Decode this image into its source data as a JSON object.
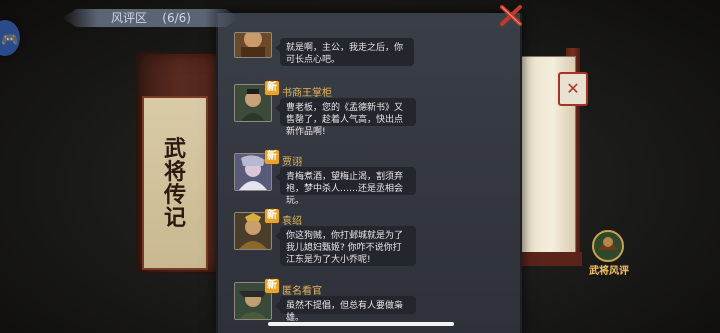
{
  "book": {
    "title_chars": [
      "武",
      "将",
      "传",
      "记"
    ],
    "seal_char": "✕"
  },
  "logo": {
    "text": "武将风评"
  },
  "panel": {
    "title": "风评区",
    "page": "(6/6)",
    "new_tag": "新"
  },
  "comments": [
    {
      "name": "",
      "new": false,
      "text": "就是啊，主公，我走之后，你可长点心吧。"
    },
    {
      "name": "书商王掌柜",
      "new": true,
      "text": "曹老板，您的《孟德新书》又售罄了，趁着人气高，快出点新作品啊!"
    },
    {
      "name": "贾诩",
      "new": true,
      "text": "青梅煮酒，望梅止渴，割须弃袍，梦中杀人……还是丞相会玩。"
    },
    {
      "name": "袁绍",
      "new": true,
      "text": "你这狗贼，你打邺城就是为了我儿媳妇甄姬? 你咋不说你打江东是为了大小乔呢!"
    },
    {
      "name": "匿名看官",
      "new": true,
      "text": "虽然不提倡，但总有人要做枭雄。"
    }
  ],
  "colors": {
    "name": "#e6b45a",
    "new_tag": "#e8a52a",
    "bubble": "#23262d",
    "panel": "#3a3e46",
    "close": "#c0392b"
  },
  "icons": {
    "close": "close-icon",
    "controller": "gamepad-icon"
  }
}
